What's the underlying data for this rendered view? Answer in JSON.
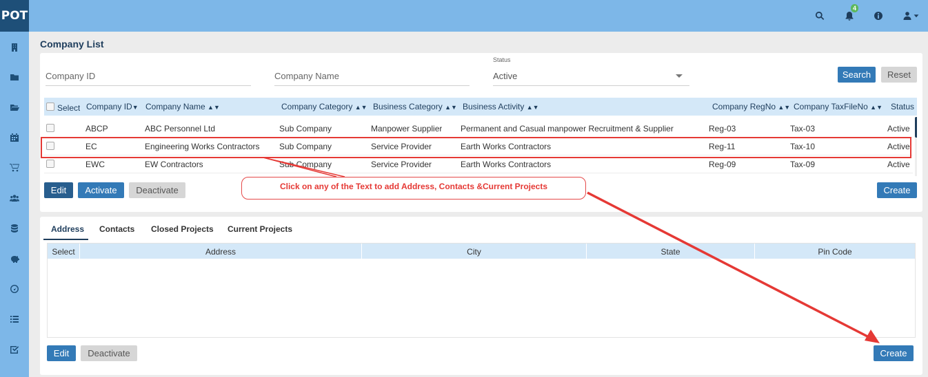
{
  "app": {
    "logo_text": "POT",
    "notification_count": "4"
  },
  "sidebar": {
    "items": [
      {
        "icon": "building-icon"
      },
      {
        "icon": "folder-icon"
      },
      {
        "icon": "folder-open-icon"
      },
      {
        "icon": "calendar-icon"
      },
      {
        "icon": "cart-icon"
      },
      {
        "icon": "users-icon"
      },
      {
        "icon": "database-icon"
      },
      {
        "icon": "piggy-bank-icon"
      },
      {
        "icon": "dashboard-icon"
      },
      {
        "icon": "list-icon"
      },
      {
        "icon": "checkbox-icon"
      }
    ]
  },
  "header": {
    "icons": [
      "search-icon",
      "bell-icon",
      "info-icon",
      "user-icon"
    ]
  },
  "page": {
    "title": "Company List"
  },
  "filters": {
    "company_id_placeholder": "Company ID",
    "company_name_placeholder": "Company Name",
    "status_label": "Status",
    "status_value": "Active",
    "search_label": "Search",
    "reset_label": "Reset"
  },
  "company_table": {
    "select_label": "Select",
    "columns": [
      "Company ID",
      "Company Name",
      "Company Category",
      "Business Category",
      "Business Activity",
      "Company RegNo",
      "Company TaxFileNo",
      "Status"
    ],
    "rows": [
      {
        "id": "ABCP",
        "name": "ABC Personnel Ltd",
        "category": "Sub Company",
        "business_category": "Manpower Supplier",
        "activity": "Permanent and Casual manpower Recruitment & Supplier",
        "regno": "Reg-03",
        "taxno": "Tax-03",
        "status": "Active"
      },
      {
        "id": "EC",
        "name": "Engineering Works Contractors",
        "category": "Sub Company",
        "business_category": "Service Provider",
        "activity": "Earth Works Contractors",
        "regno": "Reg-11",
        "taxno": "Tax-10",
        "status": "Active"
      },
      {
        "id": "EWC",
        "name": "EW Contractors",
        "category": "Sub Company",
        "business_category": "Service Provider",
        "activity": "Earth Works Contractors",
        "regno": "Reg-09",
        "taxno": "Tax-09",
        "status": "Active"
      }
    ]
  },
  "company_actions": {
    "edit": "Edit",
    "activate": "Activate",
    "deactivate": "Deactivate",
    "create": "Create"
  },
  "annotation": {
    "text": "Click on any of the Text to add Address, Contacts &Current Projects",
    "color": "#e53935"
  },
  "detail": {
    "tabs": [
      {
        "label": "Address",
        "active": true
      },
      {
        "label": "Contacts"
      },
      {
        "label": "Closed Projects"
      },
      {
        "label": "Current Projects"
      }
    ],
    "columns": [
      "Select",
      "Address",
      "City",
      "State",
      "Pin Code"
    ],
    "actions": {
      "edit": "Edit",
      "deactivate": "Deactivate",
      "create": "Create"
    }
  },
  "colors": {
    "sidebar": "#7db7e8",
    "primary": "#337ab7",
    "header_row": "#d4e8f8",
    "title": "#1e3d5c"
  }
}
